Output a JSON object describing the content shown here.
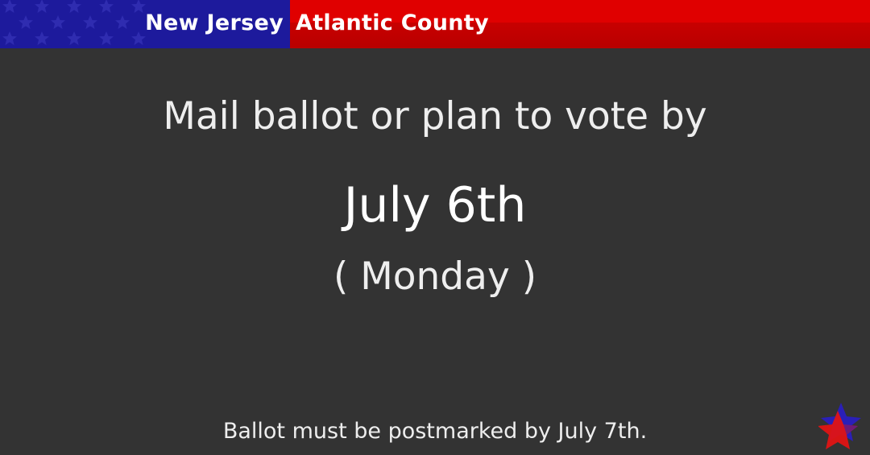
{
  "banner": {
    "state": "New Jersey",
    "county": "Atlantic County",
    "colors": {
      "blue": "#1d1a9c",
      "red": "#e00000"
    }
  },
  "main": {
    "headline": "Mail ballot or plan to vote by",
    "date": "July 6th",
    "weekday": "( Monday )"
  },
  "footer": {
    "note": "Ballot must be postmarked by July 7th."
  },
  "logo": {
    "icon": "star-logo-icon"
  }
}
